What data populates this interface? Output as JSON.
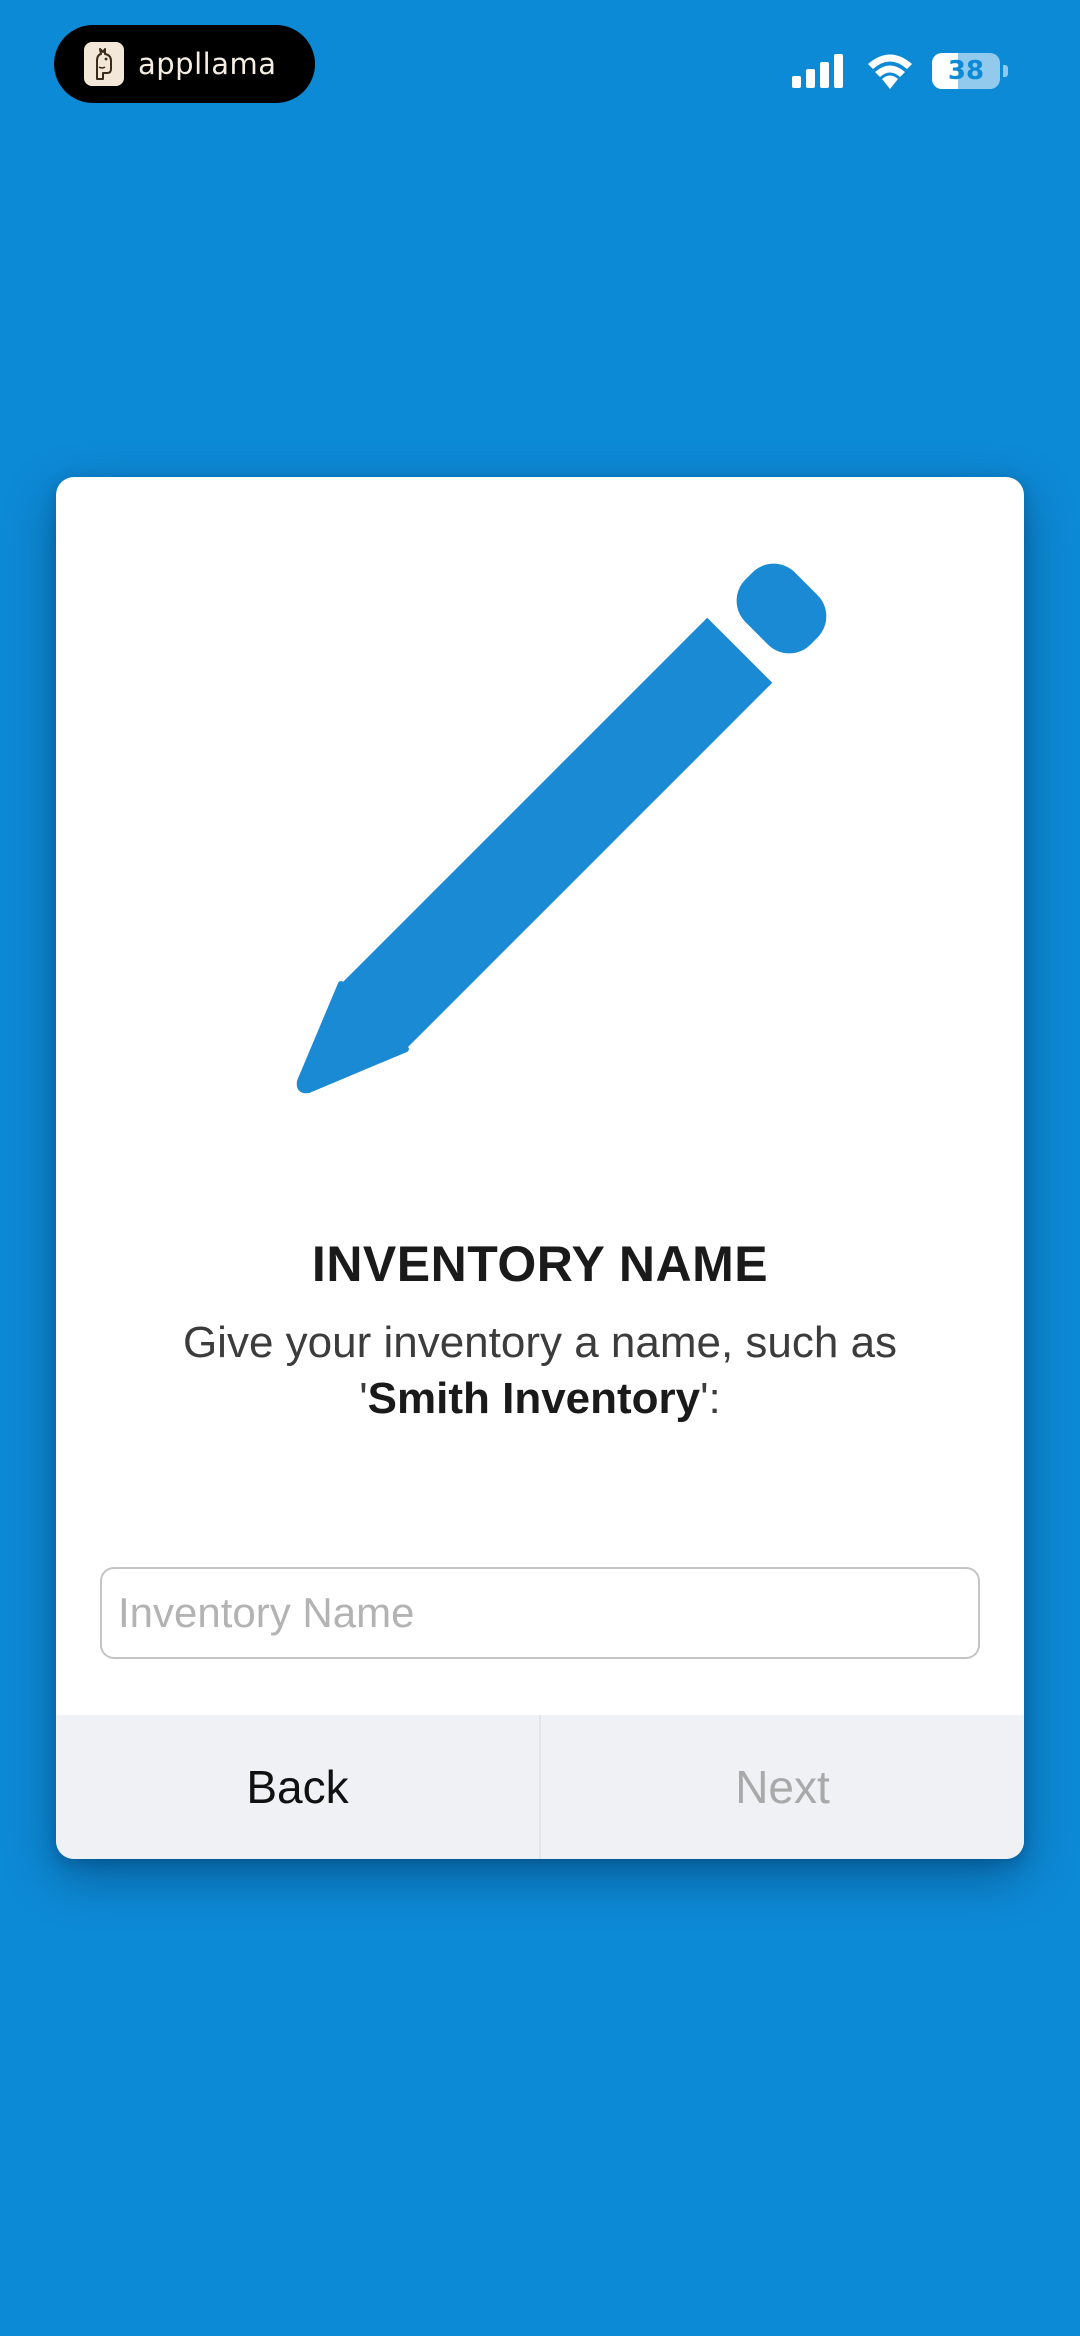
{
  "status_bar": {
    "app_badge_text": "appllama",
    "battery_level": "38",
    "battery_fraction": 0.38,
    "icons": [
      "signal-icon",
      "wifi-icon",
      "battery-icon"
    ]
  },
  "card": {
    "illustration": "pencil-icon",
    "title": "INVENTORY NAME",
    "description_prefix": "Give your inventory a name, such as",
    "description_quote_open": "'",
    "description_example": "Smith Inventory",
    "description_quote_close": "':",
    "input": {
      "value": "",
      "placeholder": "Inventory Name"
    },
    "back_label": "Back",
    "next_label": "Next"
  },
  "colors": {
    "background": "#0d8ad6",
    "accent": "#1a8ad4",
    "card": "#ffffff",
    "footer": "#eff1f4",
    "disabled_text": "#a9a9a9"
  }
}
